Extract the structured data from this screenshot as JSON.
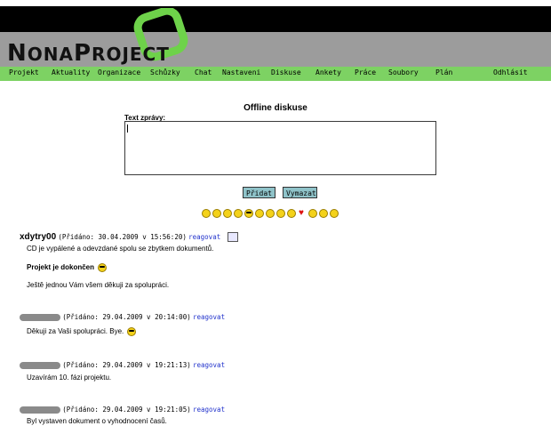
{
  "brand": {
    "logo_text": "NonaProject",
    "logo_first": "N",
    "logo_rest": "ONA",
    "logo_p": "P",
    "logo_rest2": "ROJECT",
    "accent_green": "#7dd263",
    "banner_gray": "#9c9c9c"
  },
  "menu": {
    "items": [
      "Projekt",
      "Aktuality",
      "Organizace",
      "Schůzky",
      "Chat",
      "Nastaveni",
      "Diskuse",
      "Ankety",
      "Práce",
      "Soubory",
      "Plán",
      "Odhlásit"
    ]
  },
  "page": {
    "title": "Offline diskuse",
    "field_label": "Text zprávy:",
    "message_value": "",
    "add_button": "Přidat",
    "clear_button": "Vymazat"
  },
  "smileys": [
    "smile",
    "grin",
    "sad",
    "neutral",
    "cool",
    "wink",
    "laugh",
    "tongue",
    "surprised",
    "heart",
    "angry",
    "sick",
    "confused"
  ],
  "posts": [
    {
      "author": "xdytry00",
      "meta": "(Přidáno: 30.04.2009 v 15:56:20)",
      "reply": "reagovat",
      "lines": [
        "CD je vypálené a odevzdané spolu se zbytkem dokumentů."
      ],
      "bold_line": "Projekt je dokončen",
      "extra_line": "Ještě jednou Vám všem děkuji za spolupráci."
    },
    {
      "author_hidden": true,
      "meta": "(Přidáno: 29.04.2009 v 20:14:00)",
      "reply": "reagovat",
      "line": "Děkuji za Vaši spolupráci. Bye."
    },
    {
      "author_hidden": true,
      "meta": "(Přidáno: 29.04.2009 v 19:21:13)",
      "reply": "reagovat",
      "line": "Uzavírám 10. fázi projektu."
    },
    {
      "author_hidden": true,
      "meta": "(Přidáno: 29.04.2009 v 19:21:05)",
      "reply": "reagovat",
      "line": "Byl vystaven dokument o vyhodnocení časů."
    }
  ]
}
